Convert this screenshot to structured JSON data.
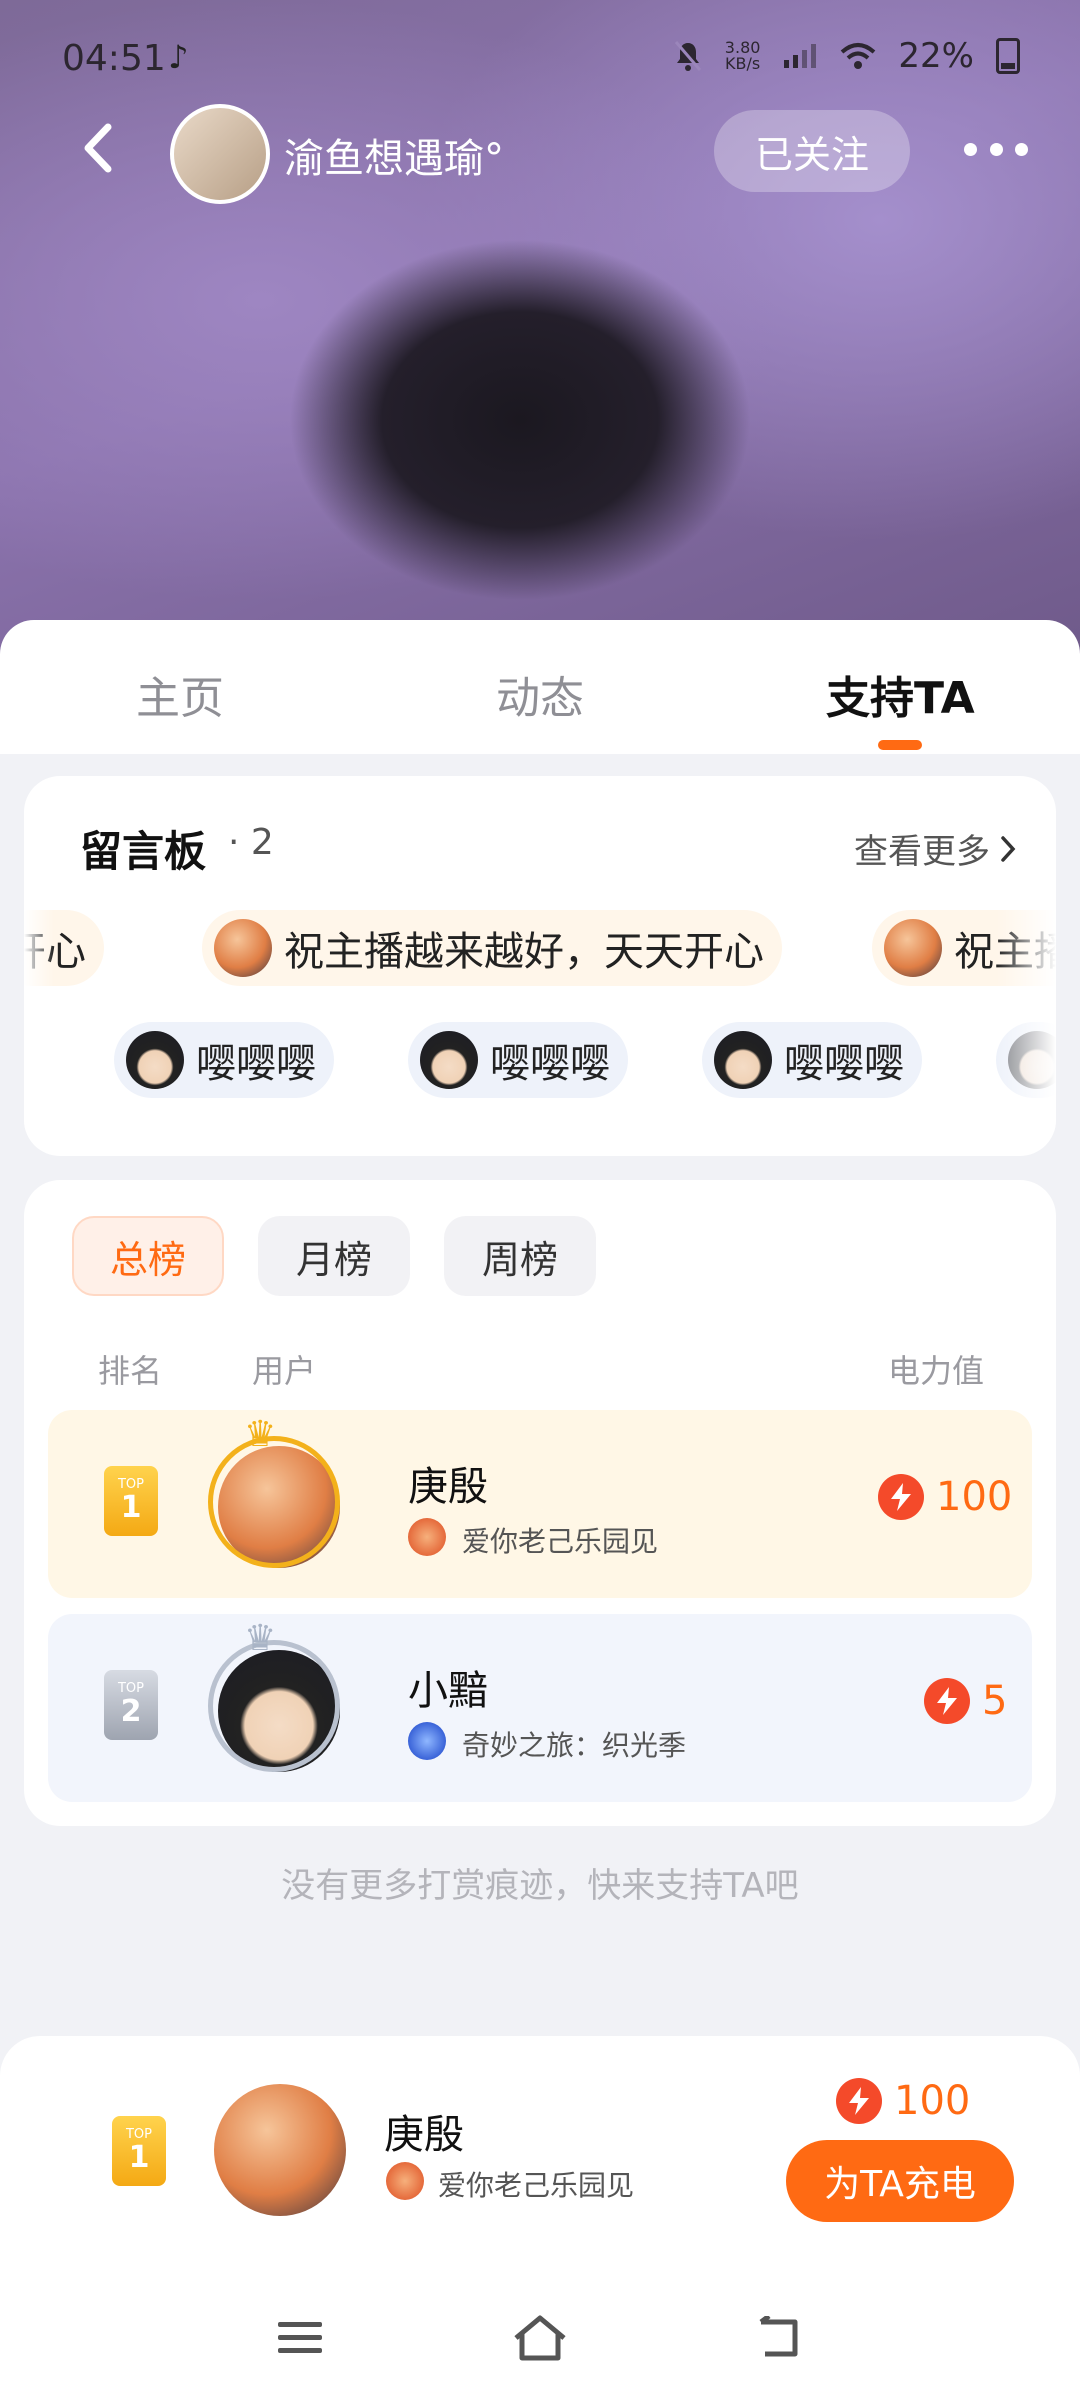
{
  "status_bar": {
    "time": "04:51",
    "app_icon": "♪",
    "net_speed_value": "3.80",
    "net_speed_unit": "KB/s",
    "battery": "22%"
  },
  "header": {
    "owner_name": "渝鱼想遇瑜°",
    "follow_label": "已关注",
    "icons": {
      "back": "back-arrow-icon",
      "more": "more-dots-icon"
    }
  },
  "tabs": [
    {
      "label": "主页"
    },
    {
      "label": "动态"
    },
    {
      "label": "支持TA"
    }
  ],
  "active_tab": "支持TA",
  "board": {
    "title": "留言板",
    "count": "· 2",
    "more_label": "查看更多",
    "row1": [
      "开心",
      "祝主播越来越好，天天开心",
      "祝主播"
    ],
    "row2": [
      "嘤嘤嘤",
      "嘤嘤嘤",
      "嘤嘤嘤"
    ]
  },
  "ranking": {
    "tabs": [
      {
        "label": "总榜"
      },
      {
        "label": "月榜"
      },
      {
        "label": "周榜"
      }
    ],
    "active": "总榜",
    "col_rank": "排名",
    "col_user": "用户",
    "col_power": "电力值",
    "rows": [
      {
        "rank_top": "TOP",
        "rank_num": "1",
        "name": "庚殷",
        "fan_club": "爱你老己乐园见",
        "power": "100"
      },
      {
        "rank_top": "TOP",
        "rank_num": "2",
        "name": "小黯",
        "fan_club": "奇妙之旅：织光季",
        "power": "5"
      }
    ],
    "end_note": "没有更多打赏痕迹，快来支持TA吧"
  },
  "my_rank": {
    "rank_top": "TOP",
    "rank_num": "1",
    "name": "庚殷",
    "fan_club": "爱你老己乐园见",
    "power": "100",
    "charge_label": "为TA充电"
  },
  "colors": {
    "accent": "#ff6a13",
    "gold": "#f3b11b",
    "bolt": "#f44a2a"
  }
}
